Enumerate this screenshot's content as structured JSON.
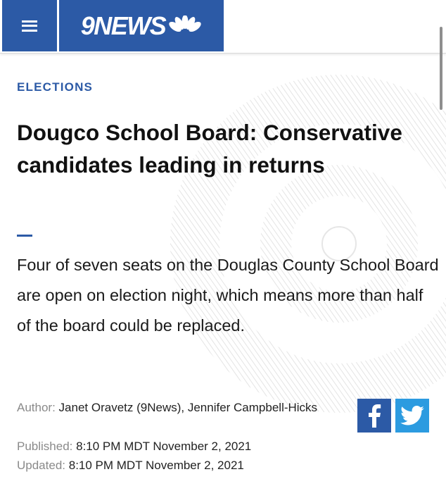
{
  "header": {
    "menu_icon": "hamburger-menu-icon",
    "logo_text": "9NEWS",
    "logo_icon": "peacock-icon",
    "brand_color": "#2c5aa6"
  },
  "article": {
    "section": "ELECTIONS",
    "headline": "Dougco School Board: Conservative candidates leading in returns",
    "summary": "Four of seven seats on the Douglas County School Board are open on election night, which means more than half of the board could be replaced.",
    "author_label": "Author:",
    "author_value": "Janet Oravetz (9News), Jennifer Campbell-Hicks",
    "published_label": "Published:",
    "published_value": "8:10 PM MDT November 2, 2021",
    "updated_label": "Updated:",
    "updated_value": "8:10 PM MDT November 2, 2021"
  },
  "share": {
    "facebook_icon": "facebook-icon",
    "twitter_icon": "twitter-icon",
    "facebook_color": "#2c5aa6",
    "twitter_color": "#2c9be0"
  }
}
